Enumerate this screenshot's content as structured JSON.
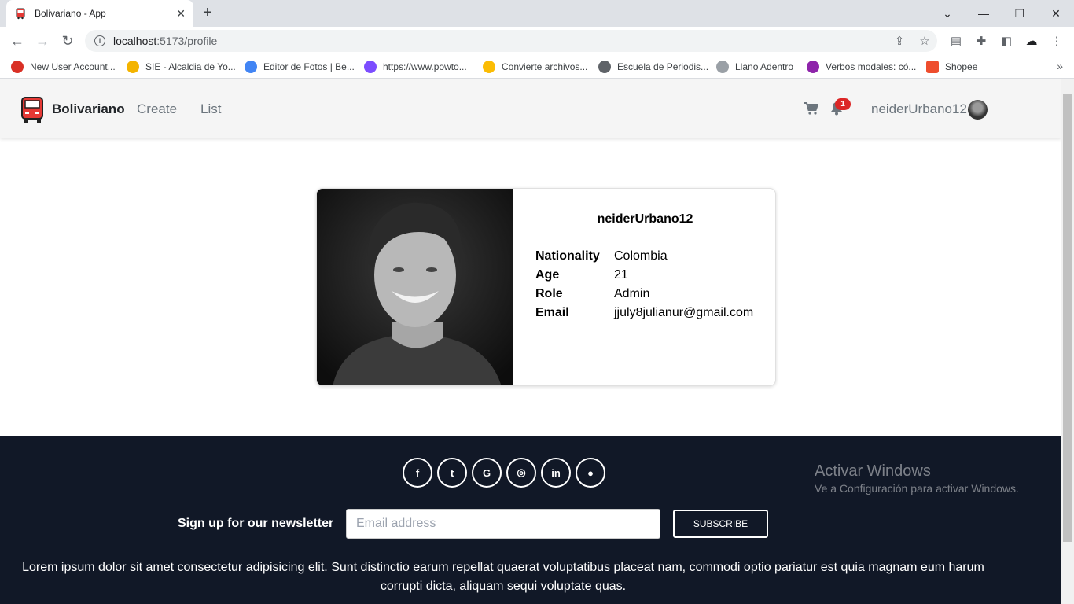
{
  "browser": {
    "tab_title": "Bolivariano - App",
    "url_host": "localhost",
    "url_path": ":5173/profile",
    "bookmarks": [
      {
        "label": "New User Account...",
        "color": "#d93025"
      },
      {
        "label": "SIE - Alcaldia de Yo...",
        "color": "#f4b400"
      },
      {
        "label": "Editor de Fotos | Be...",
        "color": "#4285f4"
      },
      {
        "label": "https://www.powto...",
        "color": "#7c4dff"
      },
      {
        "label": "Convierte archivos...",
        "color": "#fbbc04"
      },
      {
        "label": "Escuela de Periodis...",
        "color": "#5f6368"
      },
      {
        "label": "Llano Adentro",
        "color": "#9aa0a6"
      },
      {
        "label": "Verbos modales: có...",
        "color": "#8e24aa"
      },
      {
        "label": "Shopee",
        "color": "#ee4d2d"
      }
    ]
  },
  "navbar": {
    "brand": "Bolivariano",
    "links": [
      "Create",
      "List"
    ],
    "notifications": "1",
    "username": "neiderUrbano12"
  },
  "profile": {
    "username": "neiderUrbano12",
    "fields": [
      {
        "label": "Nationality",
        "value": "Colombia"
      },
      {
        "label": "Age",
        "value": "21"
      },
      {
        "label": "Role",
        "value": "Admin"
      },
      {
        "label": "Email",
        "value": "jjuly8julianur@gmail.com"
      }
    ]
  },
  "footer": {
    "social": [
      {
        "name": "facebook",
        "glyph": "f"
      },
      {
        "name": "twitter",
        "glyph": "t"
      },
      {
        "name": "google",
        "glyph": "G"
      },
      {
        "name": "instagram",
        "glyph": "◎"
      },
      {
        "name": "linkedin",
        "glyph": "in"
      },
      {
        "name": "github",
        "glyph": "●"
      }
    ],
    "newsletter_label": "Sign up for our newsletter",
    "email_placeholder": "Email address",
    "subscribe_label": "SUBSCRIBE",
    "lorem": "Lorem ipsum dolor sit amet consectetur adipisicing elit. Sunt distinctio earum repellat quaerat voluptatibus placeat nam, commodi optio pariatur est quia magnam eum harum corrupti dicta, aliquam sequi voluptate quas."
  },
  "watermark": {
    "line1": "Activar Windows",
    "line2": "Ve a Configuración para activar Windows."
  },
  "colors": {
    "footer_bg": "#111827",
    "badge": "#dc2626",
    "navbar_bg": "#f5f5f5"
  }
}
